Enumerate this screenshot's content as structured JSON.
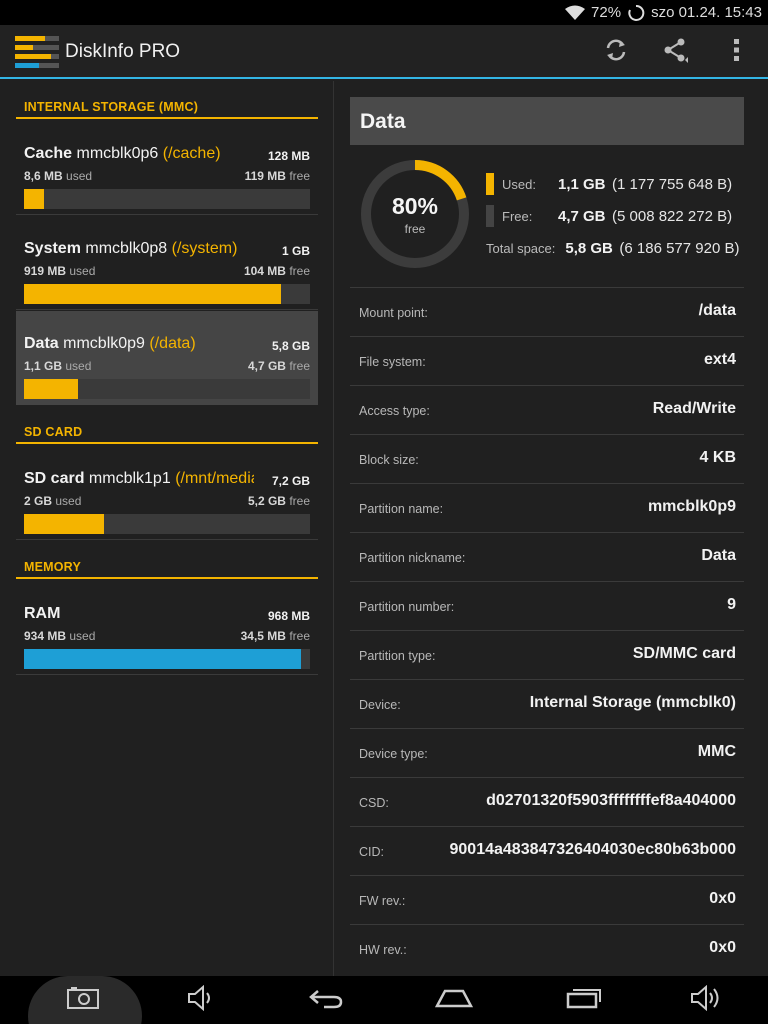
{
  "status": {
    "battery": "72%",
    "datetime": "szo 01.24. 15:43"
  },
  "app": {
    "title": "DiskInfo PRO"
  },
  "sections": {
    "internal": "INTERNAL STORAGE (MMC)",
    "sd": "SD CARD",
    "memory": "MEMORY"
  },
  "partitions": [
    {
      "label": "Cache",
      "device": "mmcblk0p6",
      "mount": "(/cache)",
      "total": "128 MB",
      "used_val": "8,6 MB",
      "used_word": "used",
      "free_val": "119 MB",
      "free_word": "free",
      "percent_used": 7,
      "color": "#f4b400"
    },
    {
      "label": "System",
      "device": "mmcblk0p8",
      "mount": "(/system)",
      "total": "1 GB",
      "used_val": "919 MB",
      "used_word": "used",
      "free_val": "104 MB",
      "free_word": "free",
      "percent_used": 90,
      "color": "#f4b400"
    },
    {
      "label": "Data",
      "device": "mmcblk0p9",
      "mount": "(/data)",
      "total": "5,8 GB",
      "used_val": "1,1 GB",
      "used_word": "used",
      "free_val": "4,7 GB",
      "free_word": "free",
      "percent_used": 19,
      "color": "#f4b400"
    },
    {
      "label": "SD card",
      "device": "mmcblk1p1",
      "mount": "(/mnt/media_…",
      "total": "7,2 GB",
      "used_val": "2 GB",
      "used_word": "used",
      "free_val": "5,2 GB",
      "free_word": "free",
      "percent_used": 28,
      "color": "#f4b400"
    },
    {
      "label": "RAM",
      "device": "",
      "mount": "",
      "total": "968 MB",
      "used_val": "934 MB",
      "used_word": "used",
      "free_val": "34,5 MB",
      "free_word": "free",
      "percent_used": 97,
      "color": "#1e9fd6"
    }
  ],
  "detail": {
    "title": "Data",
    "free_percent": "80%",
    "free_label": "free",
    "free_fraction": 0.8,
    "used_color": "#f4b400",
    "free_color": "#3c3c3c",
    "used_label": "Used:",
    "used_value": "1,1 GB",
    "used_bytes": "(1 177 755 648 B)",
    "free_row_label": "Free:",
    "free_value": "4,7 GB",
    "free_bytes": "(5 008 822 272 B)",
    "total_label": "Total space:",
    "total_value": "5,8 GB",
    "total_bytes": "(6 186 577 920 B)",
    "properties": [
      {
        "key": "Mount point:",
        "value": "/data"
      },
      {
        "key": "File system:",
        "value": "ext4"
      },
      {
        "key": "Access type:",
        "value": "Read/Write"
      },
      {
        "key": "Block size:",
        "value": "4 KB"
      },
      {
        "key": "Partition name:",
        "value": "mmcblk0p9"
      },
      {
        "key": "Partition nickname:",
        "value": "Data"
      },
      {
        "key": "Partition number:",
        "value": "9"
      },
      {
        "key": "Partition type:",
        "value": "SD/MMC card"
      },
      {
        "key": "Device:",
        "value": "Internal Storage (mmcblk0)"
      },
      {
        "key": "Device type:",
        "value": "MMC"
      },
      {
        "key": "CSD:",
        "value": "d02701320f5903ffffffffef8a404000"
      },
      {
        "key": "CID:",
        "value": "90014a483847326404030ec80b63b000"
      },
      {
        "key": "FW rev.:",
        "value": "0x0"
      },
      {
        "key": "HW rev.:",
        "value": "0x0"
      }
    ]
  },
  "icons": {
    "status": [
      "wifi-icon",
      "sync-spinner-icon"
    ],
    "actionbar": [
      "app-logo-icon",
      "refresh-icon",
      "share-icon",
      "overflow-menu-icon"
    ],
    "navbar": [
      "screenshot-icon",
      "volume-down-icon",
      "back-icon",
      "home-icon",
      "recent-apps-icon",
      "volume-up-icon"
    ]
  }
}
